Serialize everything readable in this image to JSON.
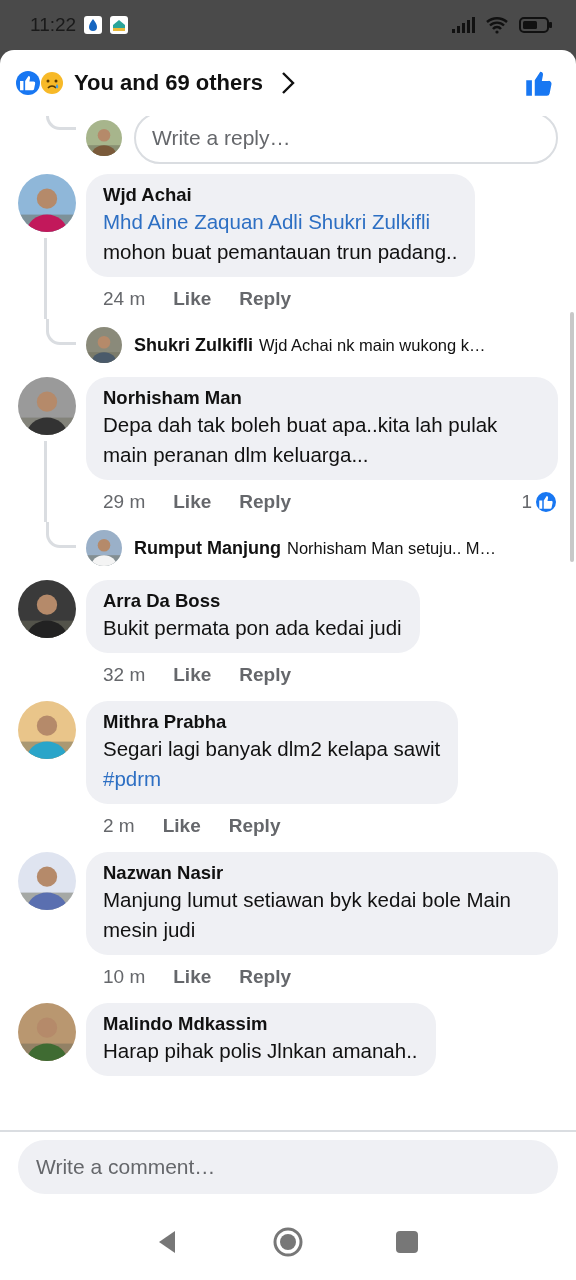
{
  "status_bar": {
    "time": "11:22"
  },
  "header": {
    "summary": "You and 69 others",
    "liked": true
  },
  "reply_box": {
    "placeholder": "Write a reply…"
  },
  "comments": [
    {
      "author": "Wjd Achai",
      "lines": [
        {
          "kind": "mention",
          "text": "Mhd Aine Zaquan Adli Shukri Zulkifli"
        },
        {
          "kind": "text",
          "text": "mohon buat pemantauan trun padang.."
        }
      ],
      "time": "24 m",
      "like": "Like",
      "reply": "Reply",
      "reply_preview": {
        "author": "Shukri Zulkifli",
        "text": "Wjd Achai  nk main wukong k…"
      }
    },
    {
      "author": "Norhisham Man",
      "lines": [
        {
          "kind": "text",
          "text": "Depa dah tak boleh buat apa..kita lah pulak main peranan dlm keluarga..."
        }
      ],
      "time": "29 m",
      "like": "Like",
      "reply": "Reply",
      "likes": "1",
      "reply_preview": {
        "author": "Rumput Manjung",
        "text": "Norhisham Man setuju.. M…"
      }
    },
    {
      "author": "Arra Da Boss",
      "lines": [
        {
          "kind": "text",
          "text": "Bukit permata pon ada kedai judi"
        }
      ],
      "time": "32 m",
      "like": "Like",
      "reply": "Reply"
    },
    {
      "author": "Mithra Prabha",
      "lines": [
        {
          "kind": "text",
          "text": "Segari lagi banyak dlm2 kelapa sawit"
        },
        {
          "kind": "mention",
          "text": "#pdrm"
        }
      ],
      "time": "2 m",
      "like": "Like",
      "reply": "Reply"
    },
    {
      "author": "Nazwan Nasir",
      "lines": [
        {
          "kind": "text",
          "text": "Manjung lumut setiawan byk kedai bole Main mesin judi"
        }
      ],
      "time": "10 m",
      "like": "Like",
      "reply": "Reply"
    },
    {
      "author": "Malindo Mdkassim",
      "lines": [
        {
          "kind": "text",
          "text": "Harap pihak polis Jlnkan amanah.."
        }
      ]
    }
  ],
  "composer": {
    "placeholder": "Write a comment…"
  }
}
